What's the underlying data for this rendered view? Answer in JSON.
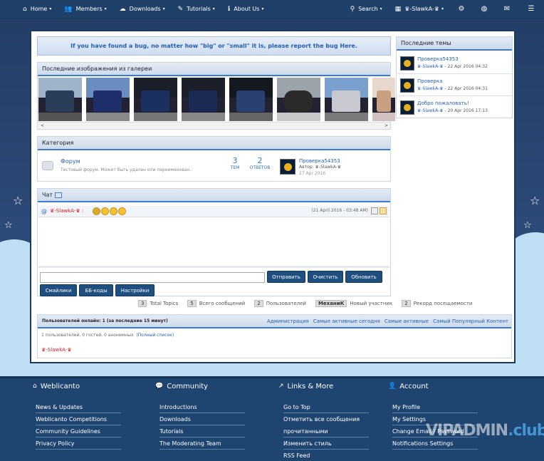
{
  "nav": {
    "home": "Home",
    "members": "Members",
    "downloads": "Downloads",
    "tutorials": "Tutorials",
    "about": "About Us",
    "search": "Search",
    "user": "♛-SlawkA-♛"
  },
  "notice": "If you have found a bug, no matter how \"big\" or \"small\" it is, please report the bug Here.",
  "gallery": {
    "title": "Последние изображения из галереи",
    "left": "<",
    "right": ">"
  },
  "categories": {
    "title": "Категория",
    "forum_name": "Форум",
    "forum_desc": "Тестовый форум. Может быть удален или переименован.",
    "topics_count": "3",
    "topics_label": "ТЕМ",
    "replies_count": "2",
    "replies_label": "ОТВЕТОВ",
    "last_title": "Проверка54353",
    "last_author": "Автор: ♛-SlawkA-♛",
    "last_date": "27 Apr 2016"
  },
  "chat": {
    "title": "Чат",
    "at": "@",
    "user": "♛-SlawkA-♛",
    "sep": ":",
    "time": "(21 April 2016 - 03:48 AM)",
    "send": "Отправить",
    "clear": "Очистить",
    "refresh": "Обновить",
    "smileys": "Смайлики",
    "bbcodes": "ББ-коды",
    "settings": "Настройки"
  },
  "stats": {
    "topics_n": "3",
    "topics_l": "Total Topics",
    "posts_n": "5",
    "posts_l": "Всего сообщений",
    "users_n": "2",
    "users_l": "Пользователей",
    "newest_nick": "МеханиК",
    "newest_l": "Новый участник",
    "record_n": "2",
    "record_l": "Рекорд посещаемости"
  },
  "online": {
    "title": "Пользователей онлайн: 1 (за последние 15 минут)",
    "link1": "Администрация",
    "link2": "Самые активные сегодня",
    "link3": "Самые активные",
    "link4": "Самый Популярный Контент",
    "summary": "1 пользователей, 0 гостей, 0 анонимных",
    "full_list": "(Полный список)",
    "user": "♛-SlawkA-♛"
  },
  "sidebar": {
    "title": "Последние темы",
    "topics": [
      {
        "title": "Проверка54353",
        "user": "♛-SlawkA-♛",
        "date": " - 22 Apr 2016 04:32"
      },
      {
        "title": "Проверка",
        "user": "♛-SlawkA-♛",
        "date": " - 22 Apr 2016 04:31"
      },
      {
        "title": "Добро пожаловать!",
        "user": "♛-SlawkA-♛",
        "date": " - 20 Apr 2016 17:13"
      }
    ]
  },
  "footer": {
    "col1": {
      "title": "Weblicanto",
      "links": [
        "News & Updates",
        "Weblicanto Competitions",
        "Community Guidelines",
        "Privacy Policy"
      ]
    },
    "col2": {
      "title": "Community",
      "links": [
        "Introductions",
        "Downloads",
        "Tutorials",
        "The Moderating Team"
      ]
    },
    "col3": {
      "title": "Links & More",
      "links": [
        "Go to Top",
        "Отметить все сообщения",
        "прочитанными",
        "Изменить стиль",
        "RSS Feed"
      ]
    },
    "col4": {
      "title": "Account",
      "links": [
        "My Profile",
        "My Settings",
        "Change Email / Password",
        "Notifications Settings"
      ]
    },
    "watermark_a": "VIPADMIN",
    "watermark_b": ".club"
  },
  "colors": {
    "nav": "#1f4068",
    "accent": "#3a7bd5",
    "link": "#2560b8",
    "user": "#d02020"
  }
}
